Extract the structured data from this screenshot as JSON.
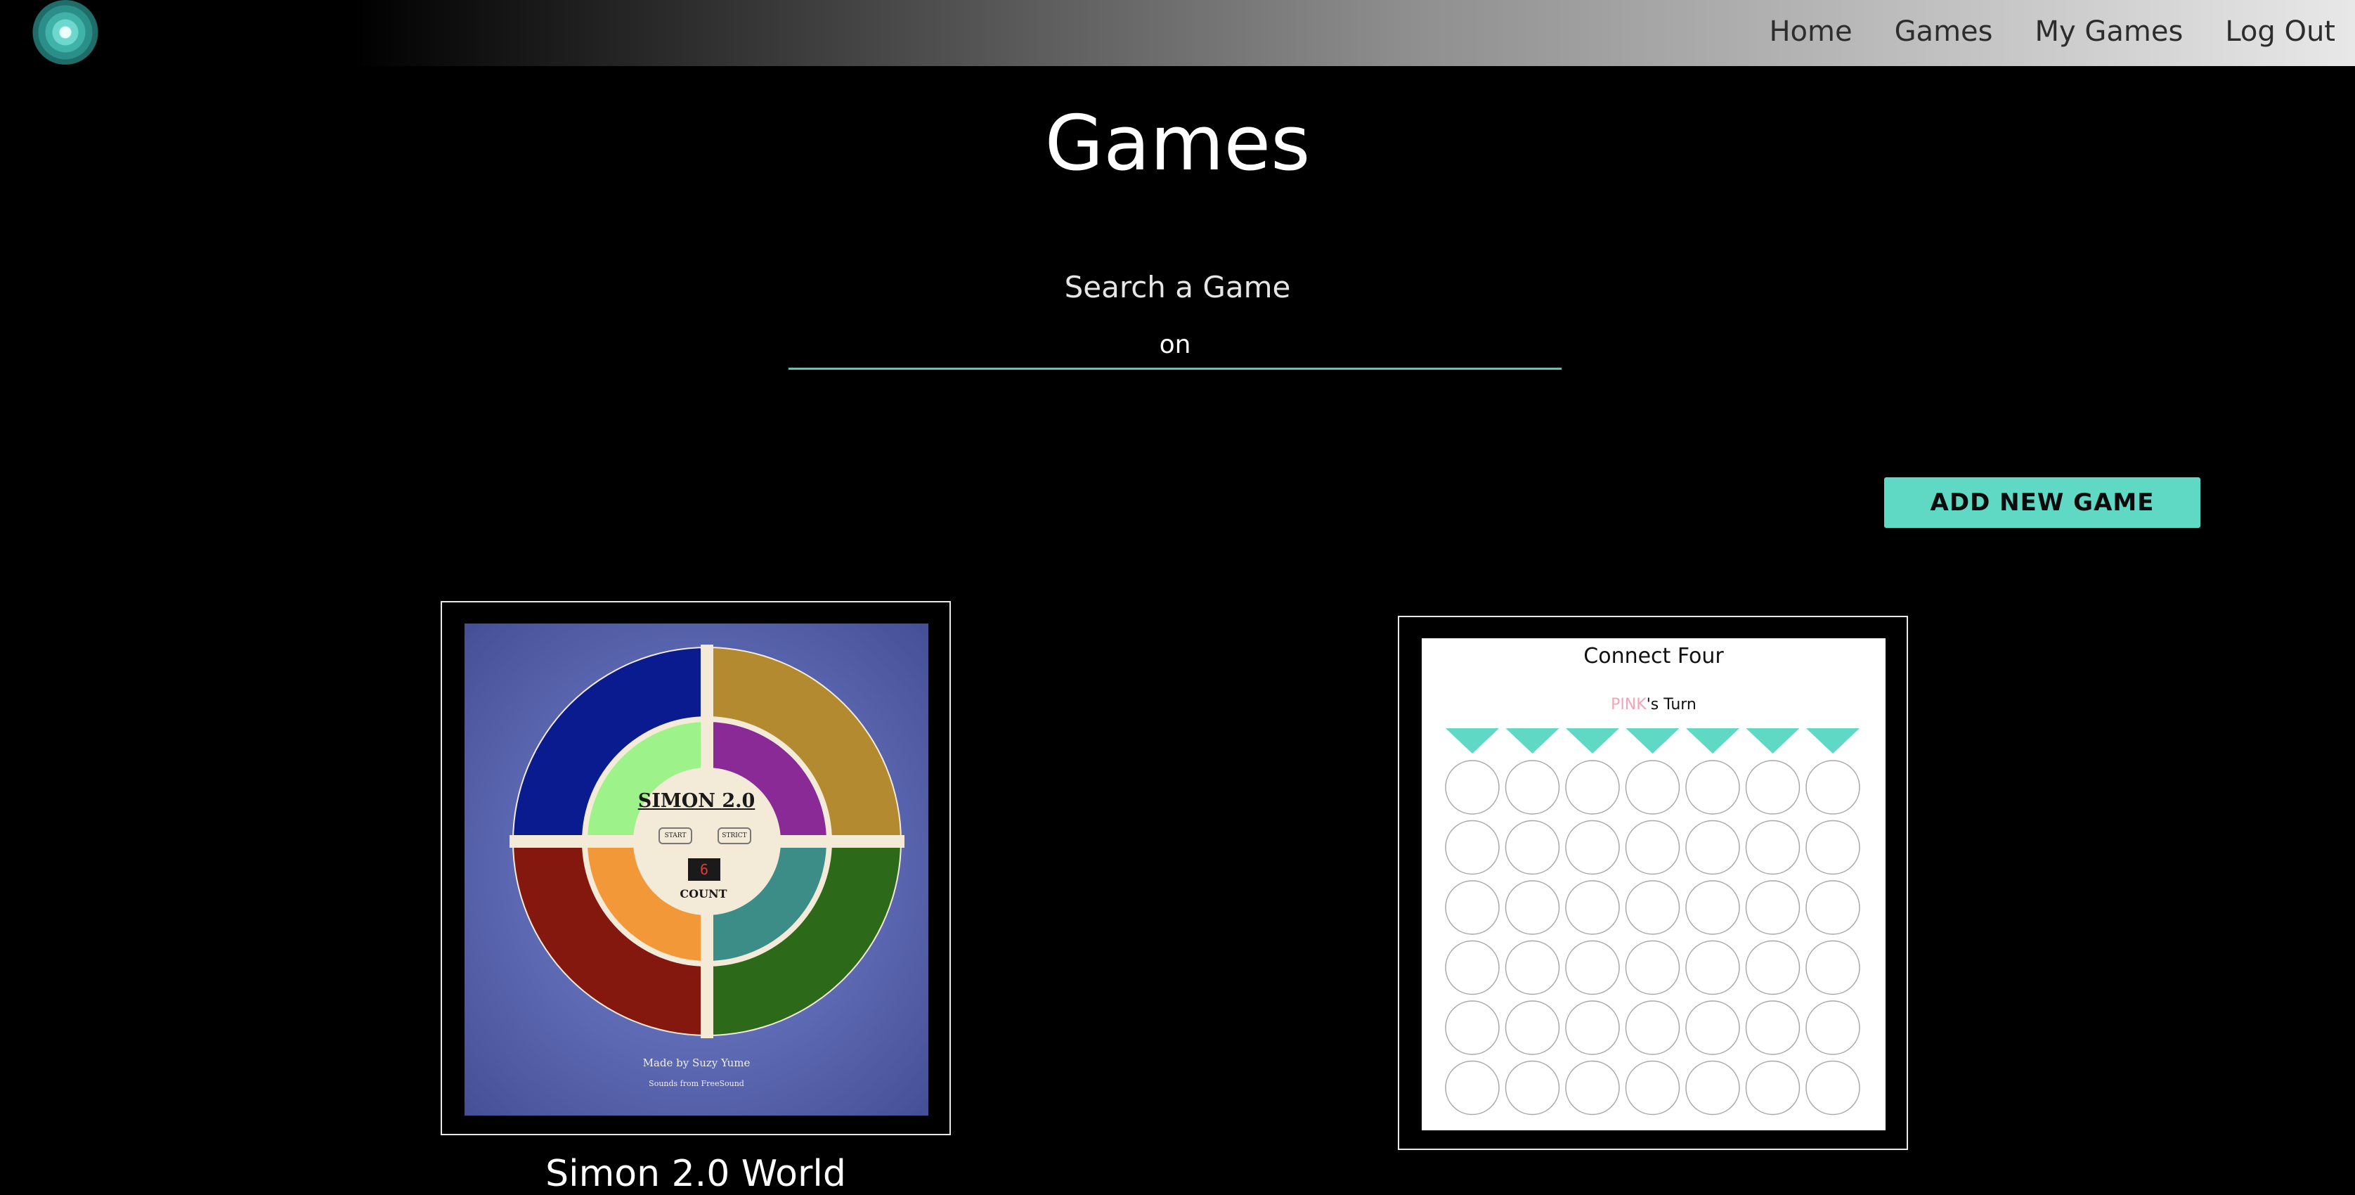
{
  "nav": {
    "links": [
      "Home",
      "Games",
      "My Games",
      "Log Out"
    ]
  },
  "page": {
    "title": "Games"
  },
  "search": {
    "label": "Search a Game",
    "value": "on"
  },
  "actions": {
    "add_game_label": "ADD NEW GAME"
  },
  "games": [
    {
      "title": "Simon 2.0 World",
      "thumbnail": {
        "heading": "SIMON 2.0",
        "start_label": "START",
        "strict_label": "STRICT",
        "count_value": "6",
        "count_label": "COUNT",
        "credit_line_1": "Made by Suzy Yume",
        "credit_line_2": "Sounds from FreeSound"
      }
    },
    {
      "title": "",
      "thumbnail": {
        "heading": "Connect Four",
        "turn_player": "PINK",
        "turn_suffix": "'s Turn"
      }
    }
  ],
  "colors": {
    "accent": "#5fd8c4",
    "search_underline": "#4ecdbd",
    "turn_player": "#f2a4b8",
    "simon_blue": "#0a1a8f",
    "simon_gold": "#b38a30",
    "simon_red": "#84180f",
    "simon_green": "#2c6a1a",
    "simon_lime": "#9ef28a",
    "simon_purple": "#8a2a96",
    "simon_orange": "#f29838",
    "simon_teal": "#3c8c88"
  },
  "icons": {
    "logo": "concentric-circle-logo-icon",
    "c4_drop": "triangle-down-icon"
  }
}
